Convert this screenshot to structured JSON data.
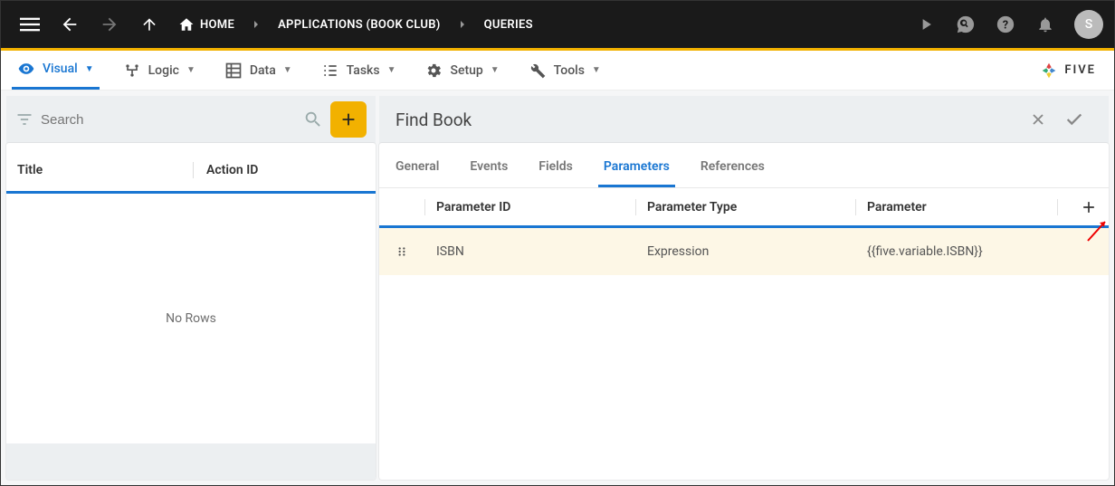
{
  "topbar": {
    "breadcrumbs": [
      {
        "label": "HOME"
      },
      {
        "label": "APPLICATIONS (BOOK CLUB)"
      },
      {
        "label": "QUERIES"
      }
    ],
    "avatar": "S"
  },
  "menubar": {
    "tabs": [
      {
        "label": "Visual",
        "active": true
      },
      {
        "label": "Logic"
      },
      {
        "label": "Data"
      },
      {
        "label": "Tasks"
      },
      {
        "label": "Setup"
      },
      {
        "label": "Tools"
      }
    ],
    "brand": "FIVE"
  },
  "left": {
    "search_placeholder": "Search",
    "columns": {
      "title": "Title",
      "action_id": "Action ID"
    },
    "no_rows": "No Rows"
  },
  "detail": {
    "title": "Find Book",
    "subtabs": [
      {
        "label": "General"
      },
      {
        "label": "Events"
      },
      {
        "label": "Fields"
      },
      {
        "label": "Parameters",
        "active": true
      },
      {
        "label": "References"
      }
    ],
    "columns": {
      "parameter_id": "Parameter ID",
      "parameter_type": "Parameter Type",
      "parameter": "Parameter"
    },
    "rows": [
      {
        "parameter_id": "ISBN",
        "parameter_type": "Expression",
        "parameter": "{{five.variable.ISBN}}"
      }
    ]
  }
}
